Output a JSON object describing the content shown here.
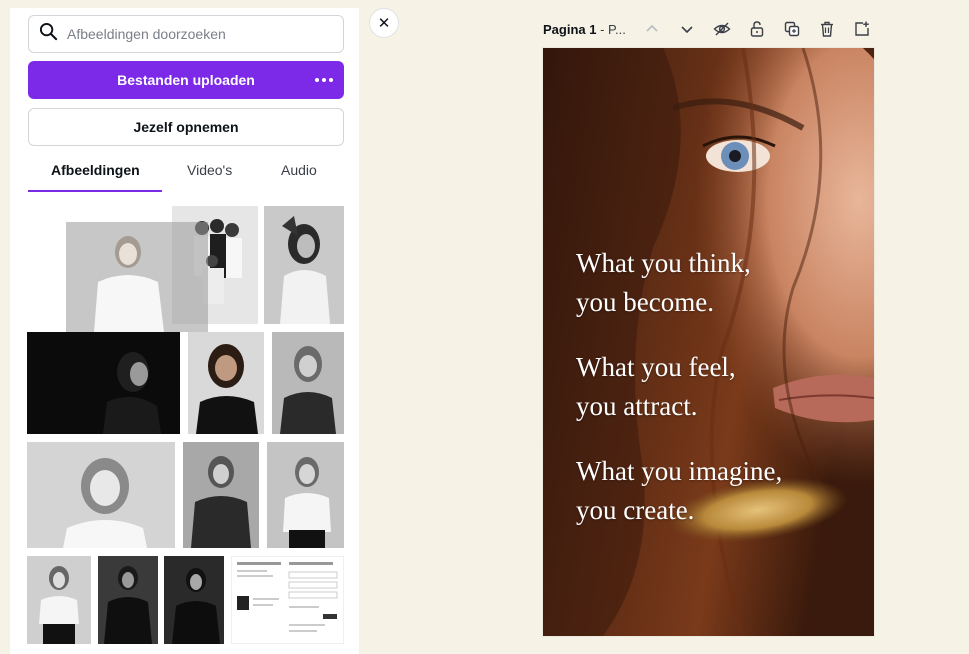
{
  "search": {
    "placeholder": "Afbeeldingen doorzoeken"
  },
  "upload": {
    "label": "Bestanden uploaden"
  },
  "record": {
    "label": "Jezelf opnemen"
  },
  "tabs": [
    {
      "label": "Afbeeldingen",
      "active": true
    },
    {
      "label": "Video's",
      "active": false
    },
    {
      "label": "Audio",
      "active": false
    }
  ],
  "page": {
    "title": "Pagina 1",
    "suffix": " - P..."
  },
  "quote": {
    "line1": "What you think,",
    "line2": "you become.",
    "line3": "What you feel,",
    "line4": "you attract.",
    "line5": "What you imagine,",
    "line6": "you create."
  },
  "colors": {
    "accent": "#7d2ae8",
    "background": "#f6f2e6",
    "panel": "#ffffff"
  },
  "icons": {
    "search": "search-icon",
    "more": "more-dots-icon",
    "close": "close-icon",
    "up": "chevron-up-icon",
    "down": "chevron-down-icon",
    "hide": "eye-icon",
    "lock": "unlock-icon",
    "duplicate": "duplicate-icon",
    "delete": "trash-icon",
    "add": "add-page-icon"
  }
}
